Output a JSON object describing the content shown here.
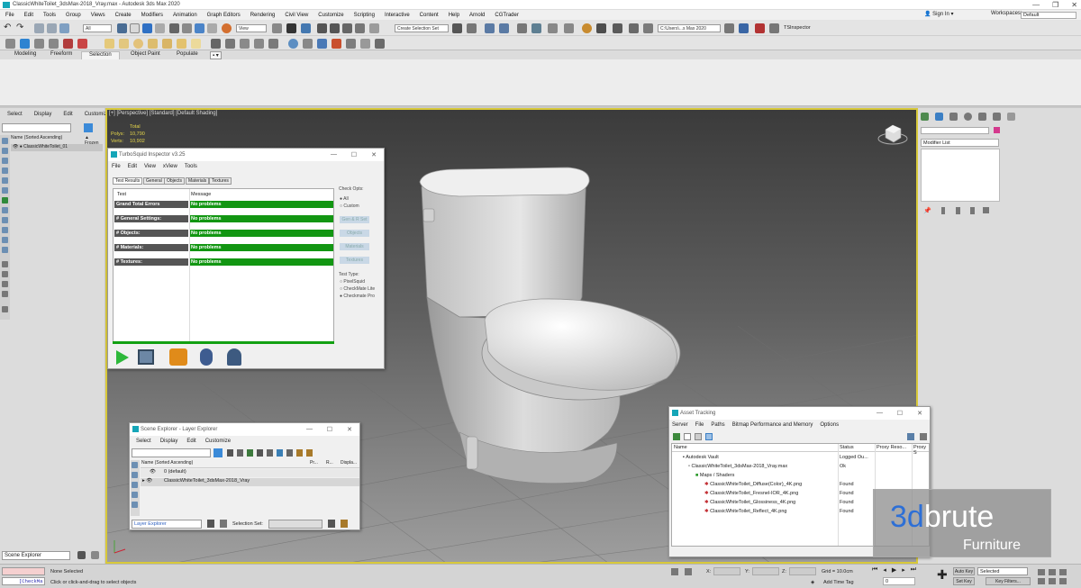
{
  "app": {
    "title": "ClassicWhiteToilet_3dsMax-2018_Vray.max - Autodesk 3ds Max 2020",
    "window_controls": [
      "—",
      "❐",
      "✕"
    ]
  },
  "menu": [
    "File",
    "Edit",
    "Tools",
    "Group",
    "Views",
    "Create",
    "Modifiers",
    "Animation",
    "Graph Editors",
    "Rendering",
    "Civil View",
    "Customize",
    "Scripting",
    "Interactive",
    "Content",
    "Help",
    "Arnold",
    "CGTrader"
  ],
  "signin": {
    "label": "Sign In"
  },
  "workspace": {
    "label": "Workspaces:",
    "value": "Default"
  },
  "toolbar": {
    "filter_combo": "All",
    "view_combo": "View",
    "selection_set": "Create Selection Set",
    "path_combo": "C:\\Users\\...s Max 2020",
    "tsinspector": "TSInspector"
  },
  "ribbon_tabs": [
    "Modeling",
    "Freeform",
    "Selection",
    "Object Paint",
    "Populate"
  ],
  "ribbon_active": "Selection",
  "left_panel": {
    "menu": [
      "Select",
      "Display",
      "Edit",
      "Customize"
    ],
    "col_name": "Name (Sorted Ascending)",
    "col_frozen": "▲ Frozen",
    "row": "ClassicWhiteToilet_01",
    "scene_explorer": "Scene Explorer"
  },
  "viewport": {
    "label": "[+] [Perspective] [Standard] [Default Shading]",
    "stats": {
      "total_label": "Total",
      "polys_label": "Polys:",
      "polys": "10,790",
      "verts_label": "Verts:",
      "verts": "10,902"
    }
  },
  "right_panel": {
    "modifier_list": "Modifier List"
  },
  "inspector": {
    "title": "TurboSquid Inspector v3.25",
    "menu": [
      "File",
      "Edit",
      "View",
      "xView",
      "Tools"
    ],
    "tabs": [
      "Test Results",
      "General",
      "Objects",
      "Materials",
      "Textures"
    ],
    "col_test": "Test",
    "col_message": "Message",
    "rows": [
      {
        "test": "Grand Total Errors",
        "message": "No problems"
      },
      {
        "test": "# General Settings:",
        "message": "No problems"
      },
      {
        "test": "# Objects:",
        "message": "No problems"
      },
      {
        "test": "# Materials:",
        "message": "No problems"
      },
      {
        "test": "# Textures:",
        "message": "No problems"
      }
    ],
    "check_opts": "Check Opts:",
    "opt_all": "All",
    "opt_custom": "Custom",
    "btns": [
      "Gen & R Set",
      "Objects",
      "Materials",
      "Textures"
    ],
    "test_type": "Test Type:",
    "types": [
      "PixelSquid",
      "CheckMate Lite",
      "Checkmate Pro"
    ]
  },
  "layer_explorer": {
    "title": "Scene Explorer - Layer Explorer",
    "menu": [
      "Select",
      "Display",
      "Edit",
      "Customize"
    ],
    "col_name": "Name (Sorted Ascending)",
    "col_pr": "Pr...",
    "col_r": "R...",
    "col_disp": "Displa...",
    "rows": [
      "0 (default)",
      "ClassicWhiteToilet_3dsMax-2018_Vray"
    ],
    "footer_combo": "Layer Explorer",
    "selection_set": "Selection Set:"
  },
  "asset_tracking": {
    "title": "Asset Tracking",
    "menu": [
      "Server",
      "File",
      "Paths",
      "Bitmap Performance and Memory",
      "Options"
    ],
    "col_name": "Name",
    "col_status": "Status",
    "col_proxy_res": "Proxy Reso...",
    "col_proxy_s": "Proxy S",
    "rows": [
      {
        "name": "Autodesk Vault",
        "status": "Logged Ou..."
      },
      {
        "name": "ClassicWhiteToilet_3dsMax-2018_Vray.max",
        "status": "Ok"
      },
      {
        "name": "Maps / Shaders",
        "status": ""
      },
      {
        "name": "ClassicWhiteToilet_Diffuse(Color)_4K.png",
        "status": "Found"
      },
      {
        "name": "ClassicWhiteToilet_Fresnel-IOR_4K.png",
        "status": "Found"
      },
      {
        "name": "ClassicWhiteToilet_Glossiness_4K.png",
        "status": "Found"
      },
      {
        "name": "ClassicWhiteToilet_Reflect_4K.png",
        "status": "Found"
      }
    ]
  },
  "watermark": {
    "brand_a": "3d",
    "brand_b": "brute",
    "sub": "Furniture"
  },
  "status": {
    "none_selected": "None Selected",
    "hint": "Click or click-and-drag to select objects",
    "script": "[CheckMa",
    "x": "X:",
    "y": "Y:",
    "z": "Z:",
    "grid": "Grid = 10.0cm",
    "add_time_tag": "Add Time Tag",
    "frame": "0",
    "auto_key": "Auto Key",
    "selected": "Selected",
    "set_key": "Set Key",
    "key_filters": "Key Filters..."
  }
}
